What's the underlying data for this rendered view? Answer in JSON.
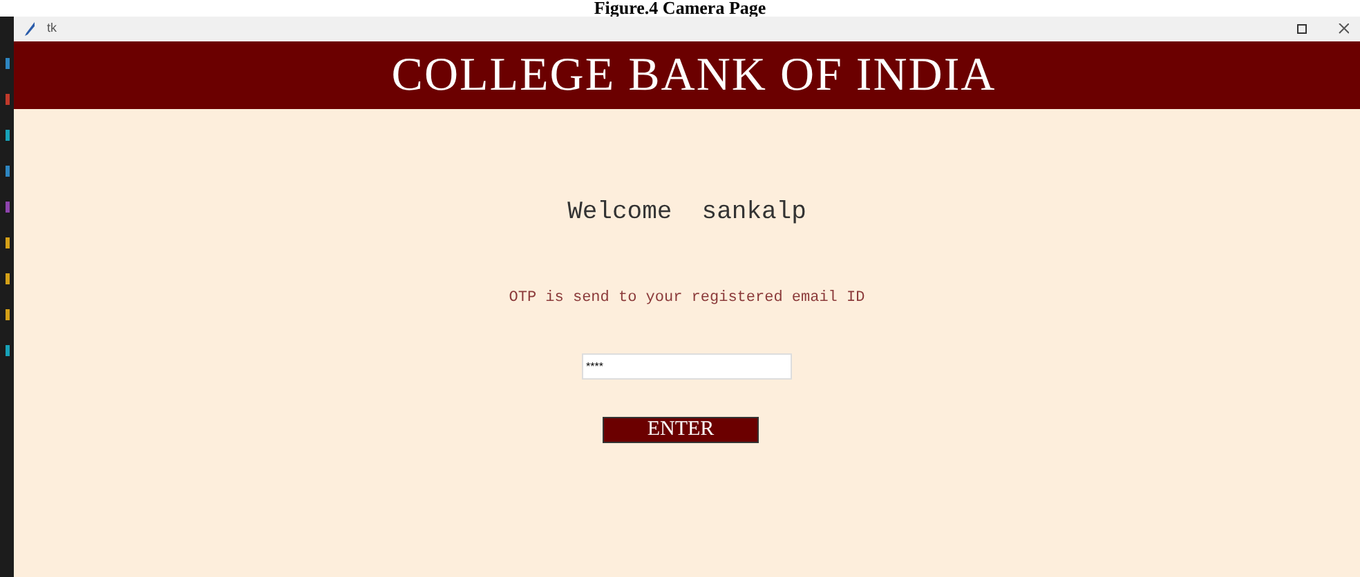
{
  "caption": "Figure.4 Camera Page",
  "window": {
    "title": "tk"
  },
  "banner": "COLLEGE BANK OF INDIA",
  "welcome": "Welcome  sankalp",
  "message": "OTP is send to your registered email ID",
  "otp_field": {
    "value": "****"
  },
  "buttons": [
    "ENTER"
  ]
}
